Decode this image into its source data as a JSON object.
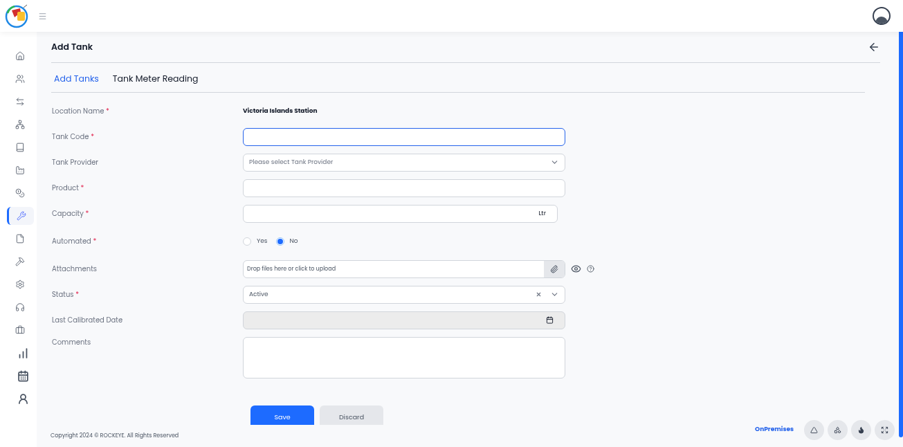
{
  "page": {
    "title": "Add Tank"
  },
  "sidebar": {
    "items": [
      {
        "selected": false
      },
      {
        "selected": false
      },
      {
        "selected": false
      },
      {
        "selected": false
      },
      {
        "selected": false
      },
      {
        "selected": false
      },
      {
        "selected": false
      },
      {
        "selected": true
      },
      {
        "selected": false
      },
      {
        "selected": false
      },
      {
        "selected": false
      },
      {
        "selected": false
      },
      {
        "selected": false
      },
      {
        "selected": false
      },
      {
        "selected": false
      },
      {
        "selected": false
      }
    ]
  },
  "tabs": [
    {
      "label": "Add Tanks",
      "selected": true
    },
    {
      "label": "Tank Meter Reading",
      "selected": false
    }
  ],
  "required_mark": "*",
  "fields": [
    {
      "kind": "static",
      "label": "Location Name",
      "required": true,
      "value": "Victoria Islands Station"
    },
    {
      "kind": "input",
      "label": "Tank Code",
      "required": true,
      "focused": true
    },
    {
      "kind": "select",
      "label": "Tank Provider",
      "required": false,
      "placeholder": "Please select Tank Provider"
    },
    {
      "kind": "input",
      "label": "Product",
      "required": true,
      "focused": false
    },
    {
      "kind": "suffix",
      "label": "Capacity",
      "required": true,
      "suffix": "Ltr"
    },
    {
      "kind": "radio",
      "label": "Automated",
      "required": true,
      "options": [
        {
          "label": "Yes",
          "selected": false
        },
        {
          "label": "No",
          "selected": true
        }
      ]
    },
    {
      "kind": "file",
      "label": "Attachments",
      "required": false,
      "placeholder": "Drop files here or click to upload"
    },
    {
      "kind": "select",
      "label": "Status",
      "required": true,
      "value": "Active",
      "clearable": true
    },
    {
      "kind": "date",
      "label": "Last Calibrated Date",
      "required": false,
      "disabled": true
    },
    {
      "kind": "textarea",
      "label": "Comments",
      "required": false
    }
  ],
  "buttons": [
    {
      "label": "Save",
      "kind": "primary"
    },
    {
      "label": "Discard",
      "kind": "secondary"
    }
  ],
  "footer": {
    "copyright": "Copyright 2024 © ROCKEYE. All Rights Reserved",
    "mode": "OnPremises"
  }
}
